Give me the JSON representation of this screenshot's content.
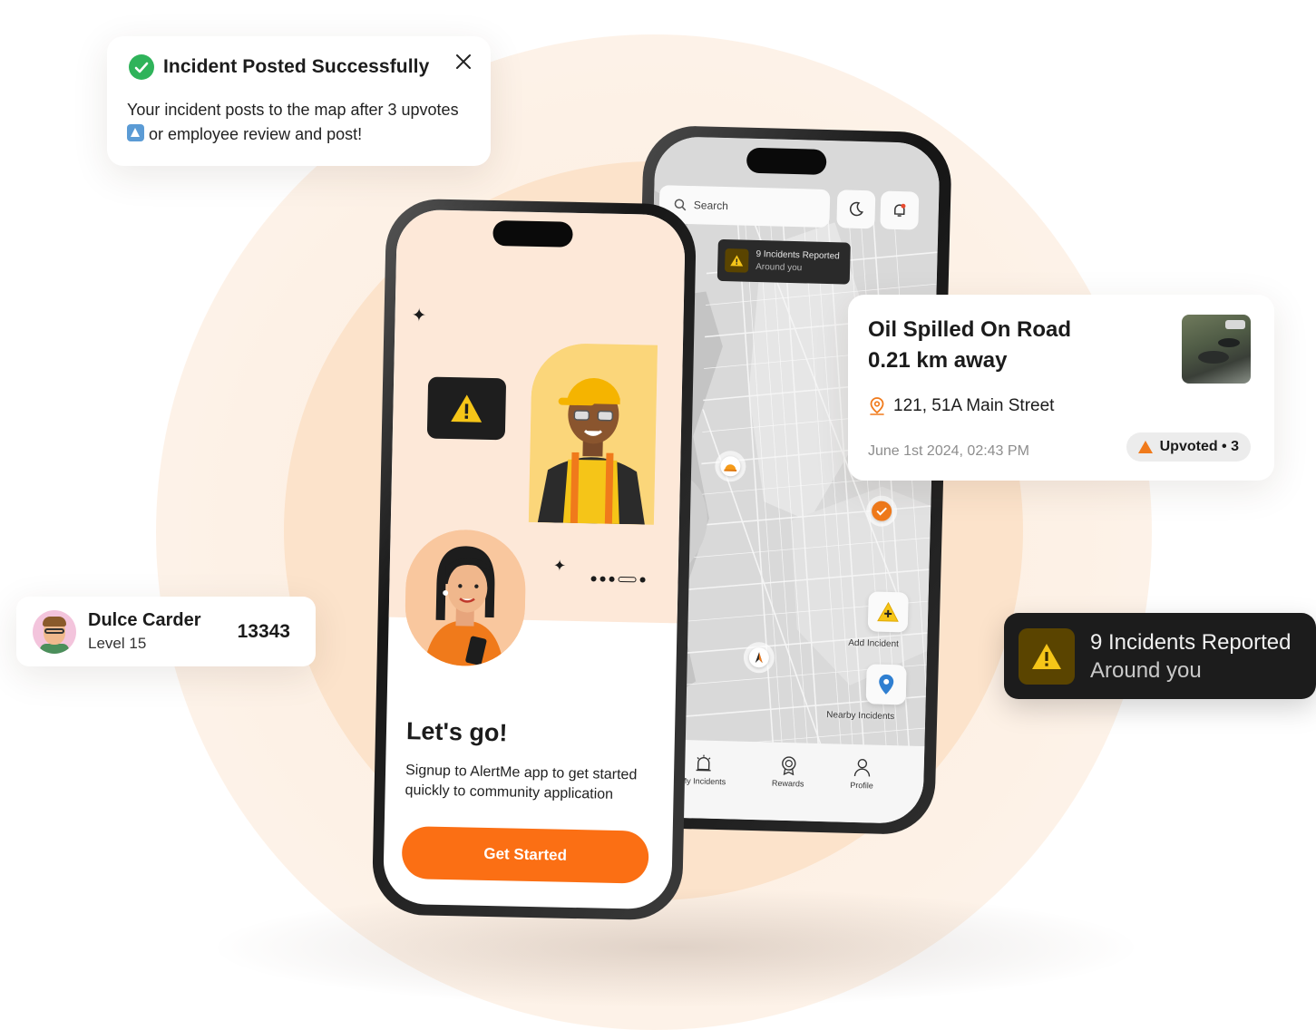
{
  "toast": {
    "title": "Incident Posted Successfully",
    "body_before": "Your incident posts to the map after 3 upvotes",
    "body_after": "or employee review and post!",
    "close_icon": "close-icon",
    "status_color": "#2fb35a"
  },
  "user": {
    "name": "Dulce Carder",
    "level": "Level 15",
    "score": "13343"
  },
  "incident_detail": {
    "title_line1": "Oil Spilled On Road",
    "title_line2": "0.21 km away",
    "address": "121, 51A Main Street",
    "date": "June 1st 2024, 02:43 PM",
    "upvote_label": "Upvoted • 3",
    "accent_color": "#f07a1b"
  },
  "incidents_chip": {
    "title": "9 Incidents Reported",
    "subtitle": "Around you"
  },
  "map_screen": {
    "search_placeholder": "Search",
    "pill_title": "9 Incidents Reported",
    "pill_subtitle": "Around you",
    "add_incident_label": "Add Incident",
    "nearby_label": "Nearby Incidents",
    "tabs": [
      {
        "label": "My Incidents",
        "icon": "siren-icon"
      },
      {
        "label": "Rewards",
        "icon": "badge-icon"
      },
      {
        "label": "Profile",
        "icon": "user-icon"
      }
    ]
  },
  "onboarding_screen": {
    "headline": "Let's go!",
    "subtext": "Signup to AlertMe app to get started quickly to community application",
    "cta_label": "Get Started",
    "brand_color": "#fb6f14"
  }
}
